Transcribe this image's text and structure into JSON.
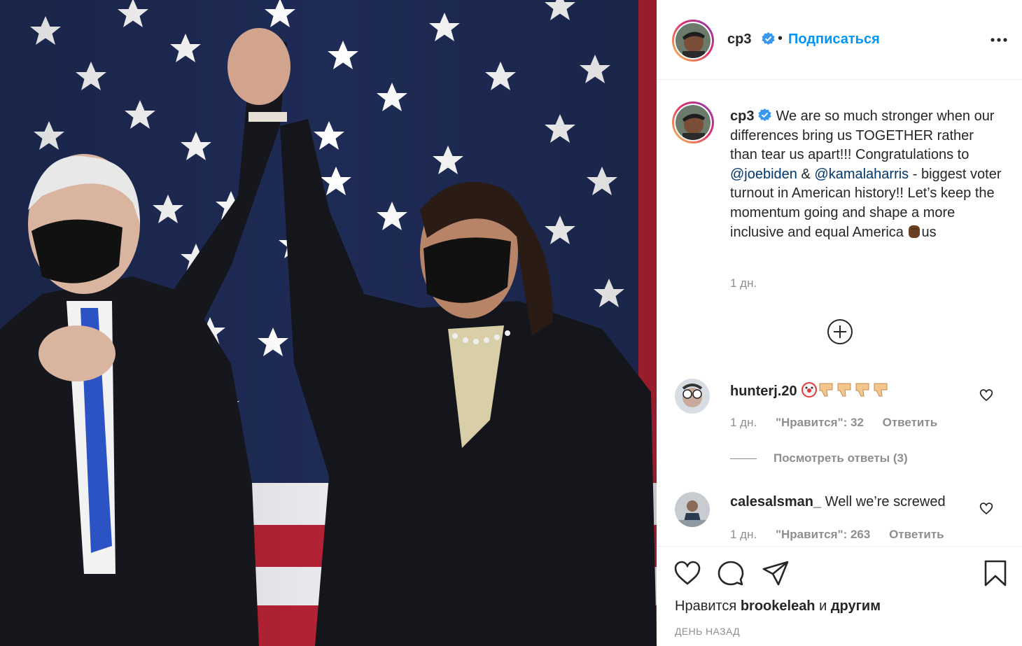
{
  "post": {
    "author": "cp3",
    "follow_label": "Подписаться",
    "separator": "•"
  },
  "caption": {
    "username": "cp3",
    "text_before": "We are so much stronger when our differences bring us TOGETHER rather than tear us apart!!! Congratulations to ",
    "mention1": "@joebiden",
    "text_mid": " & ",
    "mention2": "@kamalaharris",
    "text_after": " - biggest voter turnout in American history!! Let’s keep the momentum going and shape a more inclusive and equal America ",
    "text_end": "us",
    "time": "1 дн."
  },
  "comments": [
    {
      "username": "hunterj.20",
      "text": "",
      "emojis": [
        "clown-face",
        "thumbs-down",
        "thumbs-down",
        "thumbs-down",
        "thumbs-down"
      ],
      "time": "1 дн.",
      "likes": "\"Нравится\": 32",
      "reply": "Ответить"
    },
    {
      "username": "calesalsman_",
      "text": "Well we’re screwed",
      "time": "1 дн.",
      "likes": "\"Нравится\": 263",
      "reply": "Ответить"
    }
  ],
  "view_replies": "Посмотреть ответы (3)",
  "likes_line": {
    "prefix": "Нравится",
    "user": "brookeleah",
    "conj": "и",
    "suffix": "другим"
  },
  "post_time": "ДЕНЬ НАЗАД",
  "colors": {
    "accent": "#0095f6",
    "mention": "#00376b",
    "muted": "#8e8e8e",
    "flag_blue": "#1b2850",
    "flag_red": "#b22234"
  },
  "icons": [
    "verified-badge-icon",
    "more-options-icon",
    "plus-circle-icon",
    "heart-icon",
    "comment-icon",
    "share-icon",
    "bookmark-icon"
  ]
}
